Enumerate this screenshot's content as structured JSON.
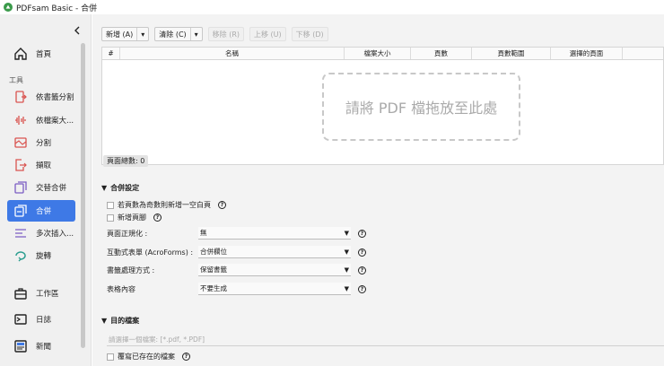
{
  "window": {
    "title": "PDFsam Basic - 合併"
  },
  "sidebar": {
    "home_label": "首頁",
    "tools_section": "工具",
    "items": [
      {
        "label": "依書籤分割",
        "icon": "split-bookmarks-icon"
      },
      {
        "label": "依檔案大...",
        "icon": "split-size-icon"
      },
      {
        "label": "分割",
        "icon": "split-icon"
      },
      {
        "label": "擷取",
        "icon": "extract-icon"
      },
      {
        "label": "交替合併",
        "icon": "alternate-mix-icon"
      },
      {
        "label": "合併",
        "icon": "merge-icon",
        "active": true
      },
      {
        "label": "多次插入...",
        "icon": "insert-multiple-icon"
      },
      {
        "label": "旋轉",
        "icon": "rotate-icon"
      }
    ],
    "workspace_label": "工作區",
    "log_label": "日誌",
    "news_label": "新聞"
  },
  "toolbar": {
    "add": "新增 (A)",
    "clear": "清除 (C)",
    "remove": "移除 (R)",
    "move_up": "上移 (U)",
    "move_down": "下移 (D)"
  },
  "table": {
    "columns": [
      "#",
      "名稱",
      "檔案大小",
      "頁數",
      "頁數範圍",
      "選擇的頁面"
    ],
    "drop_text": "請將 PDF 檔拖放至此處"
  },
  "page_count": "頁面總數: 0",
  "merge_settings": {
    "title": "合併設定",
    "blank_page_label": "若頁數為奇數則新增一空白頁",
    "footer_label": "新增頁腳",
    "normalize_label": "頁面正規化 :",
    "normalize_value": "無",
    "forms_label": "互動式表單 (AcroForms) :",
    "forms_value": "合併欄位",
    "bookmarks_label": "書籤處理方式 :",
    "bookmarks_value": "保留書籤",
    "toc_label": "表格內容",
    "toc_value": "不要生成"
  },
  "destination": {
    "title": "目的檔案",
    "placeholder": "請選擇一個檔案: [*.pdf, *.PDF]",
    "overwrite_label": "覆寫已存在的檔案"
  },
  "colors": {
    "accent": "#3e79e6",
    "icon_red": "#d9534f",
    "icon_purple": "#7b5cc4",
    "icon_teal": "#2a9d8f"
  }
}
